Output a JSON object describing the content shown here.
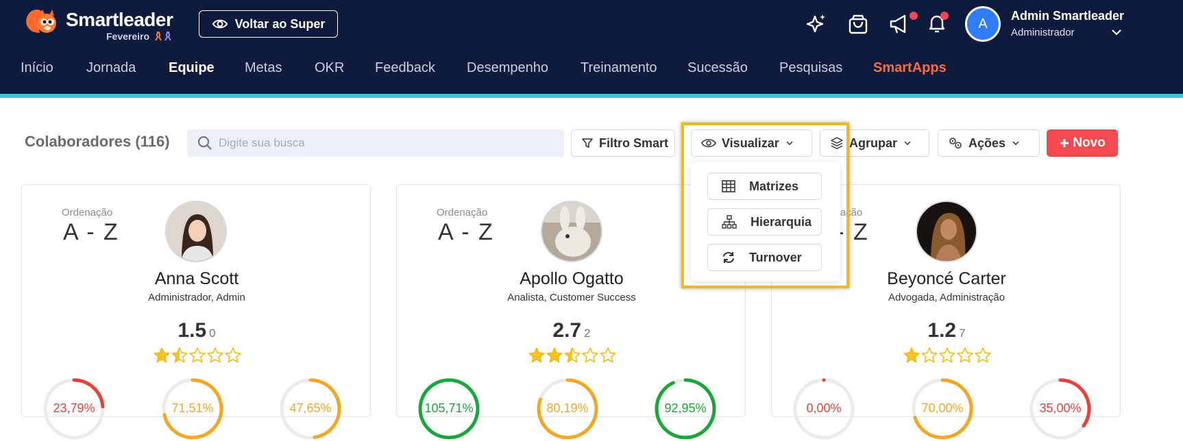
{
  "header": {
    "brand": "Smartleader",
    "brand_sub": "Fevereiro",
    "super_button": "Voltar ao Super",
    "icons": [
      "sparkle-icon",
      "shopping-bag-icon",
      "megaphone-icon",
      "bell-icon"
    ],
    "user": {
      "initial": "A",
      "name": "Admin Smartleader",
      "role": "Administrador"
    },
    "colors": {
      "background": "#0f1b3d",
      "accent": "#3cc5d2",
      "notification": "#f0475a",
      "smartapps": "#ff6a3d"
    }
  },
  "nav": {
    "items": [
      "Início",
      "Jornada",
      "Equipe",
      "Metas",
      "OKR",
      "Feedback",
      "Desempenho",
      "Treinamento",
      "Sucessão",
      "Pesquisas",
      "SmartApps"
    ],
    "active": "Equipe"
  },
  "toolbar": {
    "title": "Colaboradores (116)",
    "search_placeholder": "Digite sua busca",
    "filter_label": "Filtro Smart",
    "view_label": "Visualizar",
    "group_label": "Agrupar",
    "actions_label": "Ações",
    "new_label": "Novo",
    "new_color": "#f24a4f"
  },
  "view_menu": {
    "items": [
      {
        "label": "Matrizes",
        "icon": "table-icon"
      },
      {
        "label": "Hierarquia",
        "icon": "hierarchy-icon"
      },
      {
        "label": "Turnover",
        "icon": "refresh-icon"
      }
    ]
  },
  "cards": [
    {
      "ordering_label": "Ordenação",
      "ordering_value": "A - Z",
      "name": "Anna Scott",
      "role": "Administrador, Admin",
      "score": "1.5",
      "count": "0",
      "stars": 1.5,
      "gauges": [
        {
          "label": "23,79%",
          "value": 0.2379,
          "color": "#e8413c"
        },
        {
          "label": "71,51%",
          "value": 0.7151,
          "color": "#f5a623"
        },
        {
          "label": "47,65%",
          "value": 0.4765,
          "color": "#f5a623"
        }
      ]
    },
    {
      "ordering_label": "Ordenação",
      "ordering_value": "A - Z",
      "name": "Apollo Ogatto",
      "role": "Analista, Customer Success",
      "score": "2.7",
      "count": "2",
      "stars": 2.5,
      "gauges": [
        {
          "label": "105,71%",
          "value": 1.0,
          "color": "#1aa73a"
        },
        {
          "label": "80,19%",
          "value": 0.8019,
          "color": "#f5a623"
        },
        {
          "label": "92,95%",
          "value": 0.9295,
          "color": "#1aa73a"
        }
      ]
    },
    {
      "ordering_label": "Ordenação",
      "ordering_value": "A - Z",
      "name": "Beyoncé Carter",
      "role": "Advogada, Administração",
      "score": "1.2",
      "count": "7",
      "stars": 1,
      "gauges": [
        {
          "label": "0,00%",
          "value": 0.0,
          "color": "#e8413c"
        },
        {
          "label": "70,00%",
          "value": 0.7,
          "color": "#f5a623"
        },
        {
          "label": "35,00%",
          "value": 0.35,
          "color": "#e8413c"
        }
      ]
    }
  ]
}
